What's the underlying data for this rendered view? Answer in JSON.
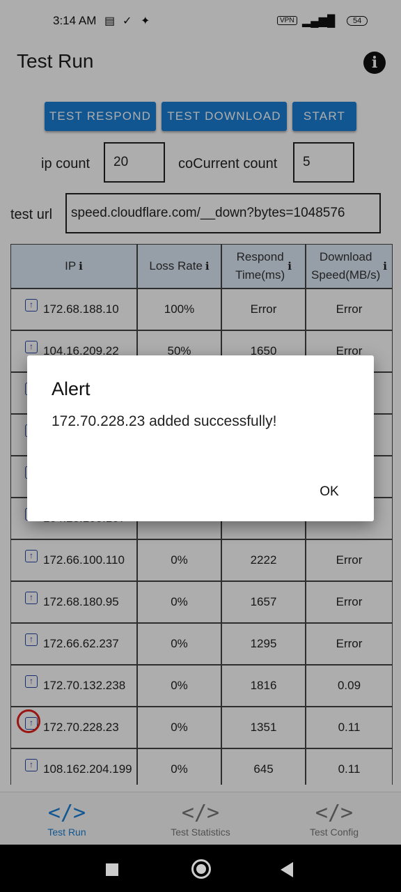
{
  "status_bar": {
    "time": "3:14 AM",
    "vpn": "VPN",
    "battery": "54"
  },
  "header": {
    "title": "Test Run",
    "info_icon": "info-icon"
  },
  "toolbar": {
    "test_respond": "TEST RESPOND",
    "test_download": "TEST DOWNLOAD",
    "start": "START"
  },
  "form": {
    "ip_count_label": "ip count",
    "ip_count_value": "20",
    "concurrent_label": "coCurrent count",
    "concurrent_value": "5",
    "test_url_label": "test url",
    "test_url_value": "speed.cloudflare.com/__down?bytes=1048576"
  },
  "table": {
    "headers": {
      "ip": "IP",
      "loss": "Loss Rate",
      "respond_1": "Respond",
      "respond_2": "Time(ms)",
      "download_1": "Download",
      "download_2": "Speed(MB/s)"
    },
    "rows": [
      {
        "ip": "172.68.188.10",
        "loss": "100%",
        "time": "Error",
        "speed": "Error"
      },
      {
        "ip": "104.16.209.22",
        "loss": "50%",
        "time": "1650",
        "speed": "Error"
      },
      {
        "ip": "",
        "loss": "",
        "time": "",
        "speed": ""
      },
      {
        "ip": "",
        "loss": "",
        "time": "",
        "speed": ""
      },
      {
        "ip": "",
        "loss": "",
        "time": "",
        "speed": ""
      },
      {
        "ip": "104.28.100.107",
        "loss": "",
        "time": "",
        "speed": ""
      },
      {
        "ip": "172.66.100.110",
        "loss": "0%",
        "time": "2222",
        "speed": "Error"
      },
      {
        "ip": "172.68.180.95",
        "loss": "0%",
        "time": "1657",
        "speed": "Error"
      },
      {
        "ip": "172.66.62.237",
        "loss": "0%",
        "time": "1295",
        "speed": "Error"
      },
      {
        "ip": "172.70.132.238",
        "loss": "0%",
        "time": "1816",
        "speed": "0.09"
      },
      {
        "ip": "172.70.228.23",
        "loss": "0%",
        "time": "1351",
        "speed": "0.11"
      },
      {
        "ip": "108.162.204.199",
        "loss": "0%",
        "time": "645",
        "speed": "0.11"
      }
    ]
  },
  "bottom_nav": {
    "items": [
      {
        "label": "Test Run",
        "icon": "code-icon",
        "color": "#1a7fd6"
      },
      {
        "label": "Test Statistics",
        "icon": "code-icon",
        "color": "#777777"
      },
      {
        "label": "Test Config",
        "icon": "code-icon",
        "color": "#777777"
      }
    ]
  },
  "dialog": {
    "title": "Alert",
    "message": "172.70.228.23 added successfully!",
    "ok": "OK"
  }
}
